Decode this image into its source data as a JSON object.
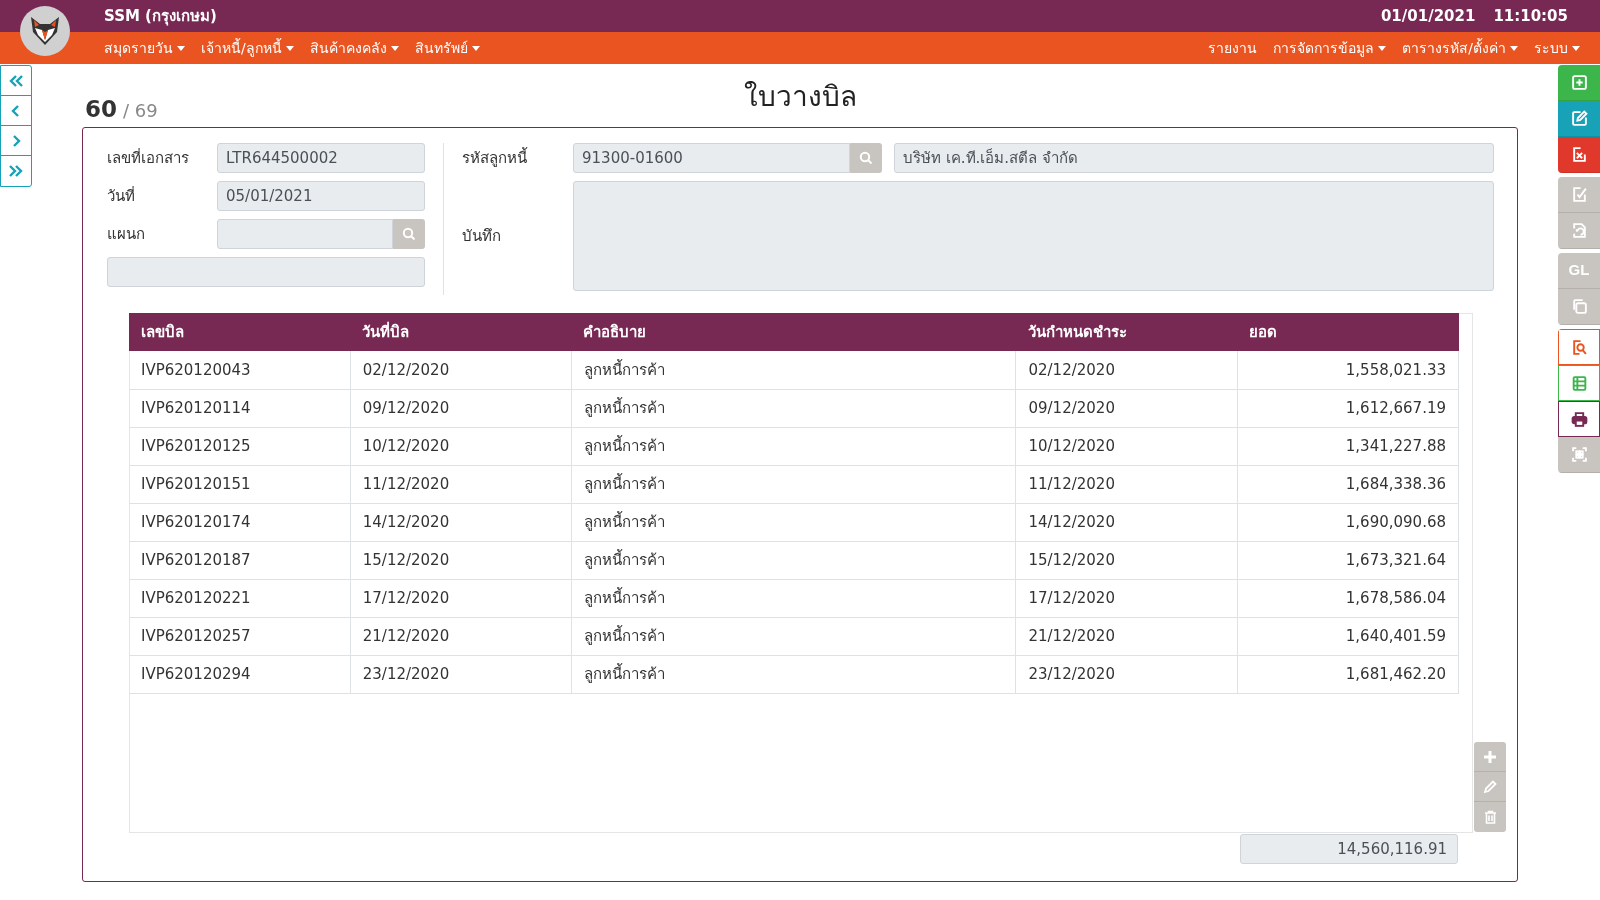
{
  "header": {
    "app_title": "SSM (กรุงเกษม)",
    "date": "01/01/2021",
    "time": "11:10:05"
  },
  "menu_left": [
    {
      "label": "สมุดรายวัน",
      "dropdown": true
    },
    {
      "label": "เจ้าหนี้/ลูกหนี้",
      "dropdown": true
    },
    {
      "label": "สินค้าคงคลัง",
      "dropdown": true
    },
    {
      "label": "สินทรัพย์",
      "dropdown": true
    }
  ],
  "menu_right": [
    {
      "label": "รายงาน",
      "dropdown": false
    },
    {
      "label": "การจัดการข้อมูล",
      "dropdown": true
    },
    {
      "label": "ตารางรหัส/ตั้งค่า",
      "dropdown": true
    },
    {
      "label": "ระบบ",
      "dropdown": true
    }
  ],
  "record": {
    "current": "60",
    "total": "/ 69"
  },
  "page_title": "ใบวางบิล",
  "form": {
    "doc_no": {
      "label": "เลขที่เอกสาร",
      "value": "LTR644500002"
    },
    "date": {
      "label": "วันที่",
      "value": "05/01/2021"
    },
    "department": {
      "label": "แผนก"
    },
    "customer_code": {
      "label": "รหัสลูกหนี้",
      "value": "91300-01600"
    },
    "customer_name": {
      "value": "บริษัท เค.ที.เอ็ม.สตีล จำกัด"
    },
    "note": {
      "label": "บันทึก"
    }
  },
  "table": {
    "columns": [
      "เลขบิล",
      "วันที่บิล",
      "คำอธิบาย",
      "วันกำหนดชำระ",
      "ยอด"
    ],
    "rows": [
      [
        "IVP620120043",
        "02/12/2020",
        "ลูกหนี้การค้า",
        "02/12/2020",
        "1,558,021.33"
      ],
      [
        "IVP620120114",
        "09/12/2020",
        "ลูกหนี้การค้า",
        "09/12/2020",
        "1,612,667.19"
      ],
      [
        "IVP620120125",
        "10/12/2020",
        "ลูกหนี้การค้า",
        "10/12/2020",
        "1,341,227.88"
      ],
      [
        "IVP620120151",
        "11/12/2020",
        "ลูกหนี้การค้า",
        "11/12/2020",
        "1,684,338.36"
      ],
      [
        "IVP620120174",
        "14/12/2020",
        "ลูกหนี้การค้า",
        "14/12/2020",
        "1,690,090.68"
      ],
      [
        "IVP620120187",
        "15/12/2020",
        "ลูกหนี้การค้า",
        "15/12/2020",
        "1,673,321.64"
      ],
      [
        "IVP620120221",
        "17/12/2020",
        "ลูกหนี้การค้า",
        "17/12/2020",
        "1,678,586.04"
      ],
      [
        "IVP620120257",
        "21/12/2020",
        "ลูกหนี้การค้า",
        "21/12/2020",
        "1,640,401.59"
      ],
      [
        "IVP620120294",
        "23/12/2020",
        "ลูกหนี้การค้า",
        "23/12/2020",
        "1,681,462.20"
      ]
    ],
    "total": "14,560,116.91"
  },
  "toolbar": {
    "groups": [
      [
        {
          "kind": "solid",
          "color": "#3cb54a"
        },
        {
          "kind": "solid",
          "color": "#17a2b8"
        },
        {
          "kind": "solid",
          "color": "#e0392b"
        }
      ],
      [
        {
          "kind": "solid",
          "color": "#c8c4bf"
        },
        {
          "kind": "solid",
          "color": "#c8c4bf"
        }
      ],
      [
        {
          "kind": "solid",
          "color": "#c8c4bf",
          "text": "GL"
        },
        {
          "kind": "solid",
          "color": "#c8c4bf"
        }
      ],
      [
        {
          "kind": "outline",
          "color": "#e95420"
        },
        {
          "kind": "outline",
          "color": "#3cb54a"
        },
        {
          "kind": "outline",
          "color": "#772953"
        },
        {
          "kind": "solid",
          "color": "#c8c4bf"
        }
      ]
    ]
  }
}
